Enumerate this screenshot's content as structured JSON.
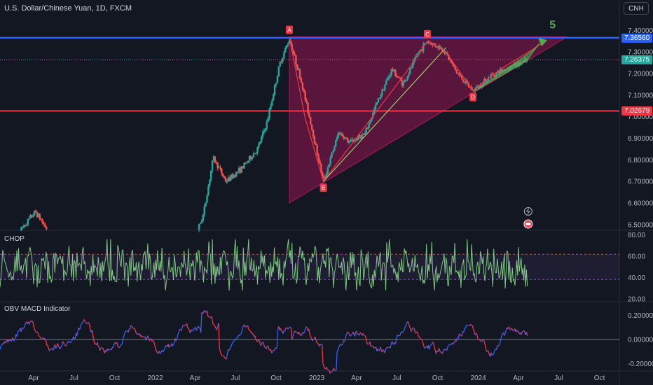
{
  "header": {
    "title": "U.S. Dollar/Chinese Yuan, 1D, FXCM",
    "currency": "CNH"
  },
  "colors": {
    "background": "#131722",
    "up": "#26a69a",
    "down": "#ef5350",
    "resistance": "#2962ff",
    "support": "#f23645",
    "triangle": "#b0155a",
    "chop": "#81c784",
    "obv_up": "#2962ff",
    "obv_down": "#f23645"
  },
  "icons": {
    "alert": "lightning-icon",
    "event": "earnings-icon"
  },
  "chart_data": [
    {
      "type": "candlestick",
      "title": "U.S. Dollar/Chinese Yuan, 1D, FXCM",
      "x_ticks": [
        "Apr",
        "Jul",
        "Oct",
        "2022",
        "Apr",
        "Jul",
        "Oct",
        "2023",
        "Apr",
        "Jul",
        "Oct",
        "2024",
        "Apr",
        "Jul",
        "Oct"
      ],
      "x_tick_dates": [
        "2021-04-01",
        "2021-07-01",
        "2021-10-01",
        "2022-01-01",
        "2022-04-01",
        "2022-07-01",
        "2022-10-01",
        "2023-01-01",
        "2023-04-01",
        "2023-07-01",
        "2023-10-01",
        "2024-01-01",
        "2024-04-01",
        "2024-07-01",
        "2024-10-01"
      ],
      "y_ticks": [
        "7.40000",
        "7.30000",
        "7.20000",
        "7.10000",
        "7.00000",
        "6.90000",
        "6.80000",
        "6.70000",
        "6.60000",
        "6.50000"
      ],
      "ylim": [
        6.48,
        7.45
      ],
      "x_range": [
        "2021-01-15",
        "2024-11-15"
      ],
      "close_path": [
        {
          "date": "2021-01-15",
          "value": 6.47
        },
        {
          "date": "2021-02-20",
          "value": 6.45
        },
        {
          "date": "2021-04-05",
          "value": 6.56
        },
        {
          "date": "2021-05-20",
          "value": 6.42
        },
        {
          "date": "2021-07-15",
          "value": 6.48
        },
        {
          "date": "2021-09-01",
          "value": 6.46
        },
        {
          "date": "2021-10-15",
          "value": 6.42
        },
        {
          "date": "2022-01-15",
          "value": 6.34
        },
        {
          "date": "2022-03-15",
          "value": 6.34
        },
        {
          "date": "2022-04-20",
          "value": 6.55
        },
        {
          "date": "2022-05-12",
          "value": 6.81
        },
        {
          "date": "2022-06-10",
          "value": 6.7
        },
        {
          "date": "2022-07-15",
          "value": 6.76
        },
        {
          "date": "2022-08-20",
          "value": 6.85
        },
        {
          "date": "2022-09-10",
          "value": 6.97
        },
        {
          "date": "2022-10-10",
          "value": 7.25
        },
        {
          "date": "2022-10-31",
          "value": 7.36
        },
        {
          "date": "2022-11-25",
          "value": 7.18
        },
        {
          "date": "2022-12-15",
          "value": 7.0
        },
        {
          "date": "2023-01-16",
          "value": 6.7
        },
        {
          "date": "2023-02-20",
          "value": 6.93
        },
        {
          "date": "2023-03-15",
          "value": 6.88
        },
        {
          "date": "2023-04-20",
          "value": 6.92
        },
        {
          "date": "2023-05-20",
          "value": 7.08
        },
        {
          "date": "2023-06-20",
          "value": 7.22
        },
        {
          "date": "2023-07-15",
          "value": 7.15
        },
        {
          "date": "2023-08-20",
          "value": 7.3
        },
        {
          "date": "2023-09-08",
          "value": 7.35
        },
        {
          "date": "2023-10-15",
          "value": 7.31
        },
        {
          "date": "2023-11-15",
          "value": 7.2
        },
        {
          "date": "2023-12-20",
          "value": 7.12
        },
        {
          "date": "2024-01-30",
          "value": 7.19
        },
        {
          "date": "2024-03-01",
          "value": 7.22
        },
        {
          "date": "2024-04-20",
          "value": 7.26
        }
      ],
      "price_lines": [
        {
          "name": "resistance",
          "value": 7.3656,
          "label": "7.36560",
          "color": "#2962ff"
        },
        {
          "name": "support",
          "value": 7.02679,
          "label": "7.02679",
          "color": "#f23645"
        },
        {
          "name": "last",
          "value": 7.26375,
          "label": "7.26375",
          "color": "#26a69a"
        }
      ],
      "triangle": [
        {
          "date": "2022-10-31",
          "value": 7.37
        },
        {
          "date": "2024-07-20",
          "value": 7.37
        },
        {
          "date": "2022-10-31",
          "value": 6.6
        }
      ],
      "points": [
        {
          "label": "A",
          "date": "2022-10-31",
          "value": 7.37,
          "position": "above"
        },
        {
          "label": "B",
          "date": "2023-01-16",
          "value": 6.7,
          "position": "below"
        },
        {
          "label": "C",
          "date": "2023-09-08",
          "value": 7.35,
          "position": "above"
        },
        {
          "label": "D",
          "date": "2023-12-20",
          "value": 7.12,
          "position": "below"
        }
      ],
      "wave_path": [
        {
          "date": "2022-10-31",
          "value": 7.37
        },
        {
          "date": "2022-12-05",
          "value": 7.0
        },
        {
          "date": "2023-01-16",
          "value": 6.7
        },
        {
          "date": "2023-07-20",
          "value": 7.2
        },
        {
          "date": "2023-09-08",
          "value": 7.35
        },
        {
          "date": "2023-10-20",
          "value": 7.3
        },
        {
          "date": "2023-12-20",
          "value": 7.12
        },
        {
          "date": "2024-02-20",
          "value": 7.22
        },
        {
          "date": "2024-05-25",
          "value": 7.34
        }
      ],
      "trendline": [
        {
          "date": "2023-01-16",
          "value": 6.7
        },
        {
          "date": "2023-10-20",
          "value": 7.32
        }
      ],
      "wave_label": {
        "text": "5",
        "date": "2024-06-10",
        "value": 7.41
      }
    },
    {
      "type": "line",
      "name": "CHOP",
      "y_ticks": [
        "80.00",
        "60.00",
        "40.00",
        "20.00"
      ],
      "ylim": [
        18,
        83
      ],
      "bands": [
        61.8,
        38.2
      ]
    },
    {
      "type": "line",
      "name": "OBV MACD Indicator",
      "y_ticks": [
        "0.20000",
        "0.00000",
        "-0.20000"
      ],
      "ylim": [
        -0.25,
        0.3
      ],
      "series_colors": [
        "#2962ff",
        "#f23645"
      ]
    }
  ]
}
